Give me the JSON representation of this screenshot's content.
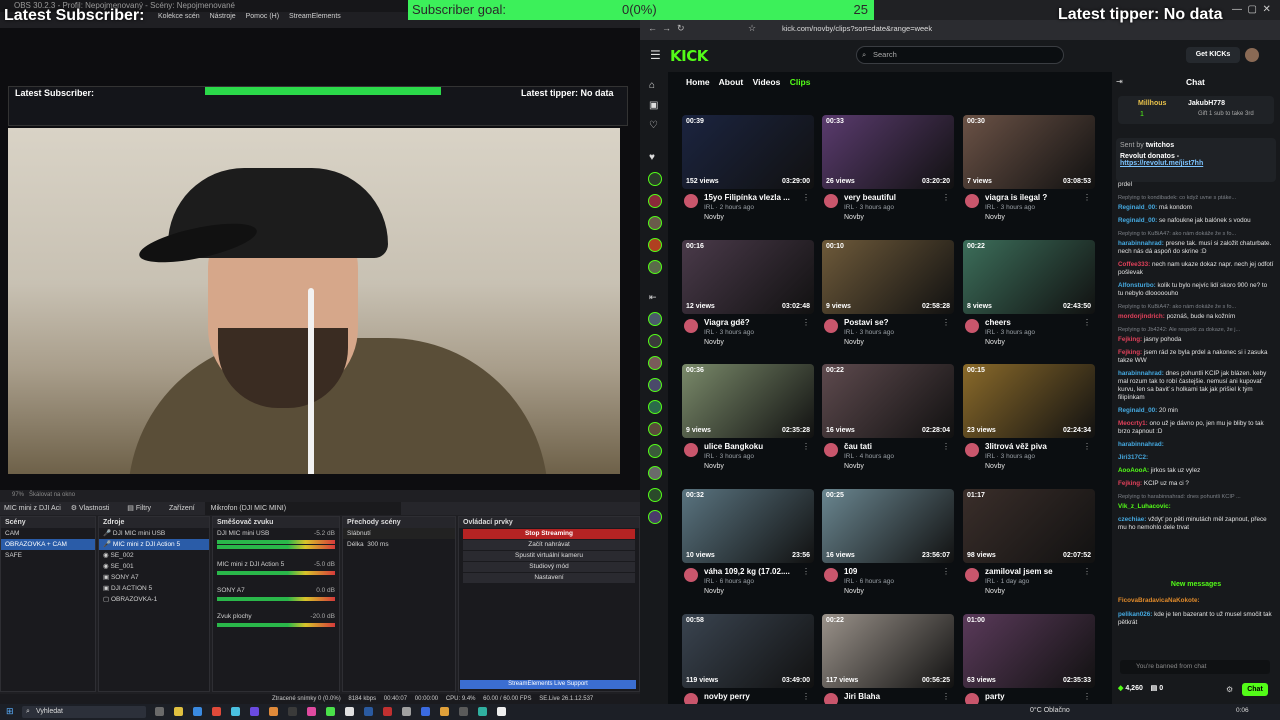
{
  "overlay": {
    "latest_subscriber": "Latest Subscriber:",
    "goal_label": "Subscriber goal:",
    "goal_value": "0(0%)",
    "goal_target": "25",
    "latest_tipper": "Latest tipper: No data"
  },
  "obs": {
    "menu": [
      "Kolekce scén",
      "Nástroje",
      "Pomoc (H)",
      "StreamElements"
    ],
    "scale_label": "97%",
    "scale_mode": "Škálovat na okno",
    "toolbar": {
      "selected_source": "MIC mini z DJI Aci",
      "properties": "Vlastnosti",
      "filters": "Filtry",
      "devices": "Zařízení",
      "device_value": "Mikrofon (DJI MIC MINI)"
    },
    "scenes": {
      "title": "Scény",
      "items": [
        "CAM",
        "OBRAZOVKA + CAM",
        "SAFE"
      ],
      "selected": 1
    },
    "sources": {
      "title": "Zdroje",
      "items": [
        "DJI MIC mini USB",
        "MIC mini z DJI Action 5",
        "SE_002",
        "SE_001",
        "SONY A7",
        "DJI ACTION 5",
        "OBRAZOVKA-1"
      ],
      "selected": 1
    },
    "mixer": {
      "title": "Směšovač zvuku",
      "channels": [
        {
          "name": "DJI MIC mini USB",
          "db": "-5.2 dB"
        },
        {
          "name": "MIC mini z DJI Action 5",
          "db": "-5.0 dB"
        },
        {
          "name": "SONY A7",
          "db": "0.0 dB"
        },
        {
          "name": "Zvuk plochy",
          "db": "-20.0 dB"
        }
      ]
    },
    "transitions": {
      "title": "Přechody scény",
      "type": "Slábnutí",
      "duration_label": "Délka",
      "duration": "300 ms"
    },
    "controls": {
      "title": "Ovládací prvky",
      "buttons": [
        "Stop Streaming",
        "Začít nahrávat",
        "Spustit virtuální kameru",
        "Studiový mód",
        "Nastavení"
      ]
    },
    "se_support": "StreamElements Live Support",
    "status": {
      "dropped": "Ztracené snímky 0 (0.0%)",
      "kbps": "8184 kbps",
      "time1": "00:40:07",
      "time2": "00:00:00",
      "cpu": "CPU: 9.4%",
      "fps": "60.00 / 60.00 FPS",
      "version": "SE.Live 26.1.12.537"
    }
  },
  "browser": {
    "url": "kick.com/novby/clips?sort=date&range=week",
    "search_placeholder": "Search",
    "get_kicks": "Get KICKs",
    "logo": "KICK",
    "tabs": [
      "Home",
      "About",
      "Videos",
      "Clips"
    ],
    "active_tab": "Clips",
    "clips": [
      {
        "dur": "00:39",
        "views": "152 views",
        "ts": "03:29:00",
        "title": "15yo Filipínka vlezla ...",
        "cat": "IRL · 2 hours ago",
        "channel": "Novby",
        "color": "#1b2440"
      },
      {
        "dur": "00:33",
        "views": "26 views",
        "ts": "03:20:20",
        "title": "very beautiful",
        "cat": "IRL · 3 hours ago",
        "channel": "Novby",
        "color": "#5a3b6e"
      },
      {
        "dur": "00:30",
        "views": "7 views",
        "ts": "03:08:53",
        "title": "viagra is ilegal ?",
        "cat": "IRL · 3 hours ago",
        "channel": "Novby",
        "color": "#6b5246"
      },
      {
        "dur": "00:16",
        "views": "12 views",
        "ts": "03:02:48",
        "title": "Viagra gdě?",
        "cat": "IRL · 3 hours ago",
        "channel": "Novby",
        "color": "#4a3a4a"
      },
      {
        "dur": "00:10",
        "views": "9 views",
        "ts": "02:58:28",
        "title": "Postavi se?",
        "cat": "IRL · 3 hours ago",
        "channel": "Novby",
        "color": "#6e5a3a"
      },
      {
        "dur": "00:22",
        "views": "8 views",
        "ts": "02:43:50",
        "title": "cheers",
        "cat": "IRL · 3 hours ago",
        "channel": "Novby",
        "color": "#3c6e5a"
      },
      {
        "dur": "00:36",
        "views": "9 views",
        "ts": "02:35:28",
        "title": "ulice Bangkoku",
        "cat": "IRL · 3 hours ago",
        "channel": "Novby",
        "color": "#7a8a6a"
      },
      {
        "dur": "00:22",
        "views": "16 views",
        "ts": "02:28:04",
        "title": "čau tati",
        "cat": "IRL · 4 hours ago",
        "channel": "Novby",
        "color": "#5e4a4e"
      },
      {
        "dur": "00:15",
        "views": "23 views",
        "ts": "02:24:34",
        "title": "3litrová věž piva",
        "cat": "IRL · 3 hours ago",
        "channel": "Novby",
        "color": "#8a6a2a"
      },
      {
        "dur": "00:32",
        "views": "10 views",
        "ts": "23:56",
        "title": "váha 109,2 kg (17.02....",
        "cat": "IRL · 6 hours ago",
        "channel": "Novby",
        "color": "#5a7480"
      },
      {
        "dur": "00:25",
        "views": "16 views",
        "ts": "23:56:07",
        "title": "109",
        "cat": "IRL · 6 hours ago",
        "channel": "Novby",
        "color": "#6a8690"
      },
      {
        "dur": "01:17",
        "views": "98 views",
        "ts": "02:07:52",
        "title": "zamilovaI jsem se",
        "cat": "IRL · 1 day ago",
        "channel": "Novby",
        "color": "#3a2e2a"
      },
      {
        "dur": "00:58",
        "views": "119 views",
        "ts": "03:49:00",
        "title": "novby perry",
        "cat": "",
        "channel": "",
        "color": "#3a4450"
      },
      {
        "dur": "00:22",
        "views": "117 views",
        "ts": "00:56:25",
        "title": "Jiri Blaha",
        "cat": "",
        "channel": "",
        "color": "#9a928a"
      },
      {
        "dur": "01:00",
        "views": "63 views",
        "ts": "02:35:33",
        "title": "party",
        "cat": "",
        "channel": "",
        "color": "#5a3a5a"
      }
    ]
  },
  "chat": {
    "title": "Chat",
    "gift": {
      "user1": "Millhous",
      "user2": "JakubH778",
      "count": "1",
      "text": "Gift 1 sub to take 3rd"
    },
    "pinned": {
      "sent_by": "Sent by",
      "user": "twitchos",
      "text": "Revolut donatos -",
      "link": "https://revolut.me/jist7hh"
    },
    "lines": [
      {
        "user": "",
        "text": "prdel",
        "reply": false,
        "color": "#e3e3e3"
      },
      {
        "user": "",
        "text": "Replying to kondibadek: co když uvne s ptáke...",
        "reply": true,
        "color": "#7c8087"
      },
      {
        "user": "Reginald_00:",
        "text": "má kondom",
        "reply": false,
        "color": "#45a9e0"
      },
      {
        "user": "Reginald_00:",
        "text": "se nafoukne jak balónek s vodou",
        "reply": false,
        "color": "#45a9e0"
      },
      {
        "user": "",
        "text": "Replying to KuBiA47: ako nám dokáže že s fo...",
        "reply": true,
        "color": "#7c8087"
      },
      {
        "user": "harabinnahrad:",
        "text": "presne tak. musí si založit chaturbate. nech nás dá aspoň do skrine :D",
        "reply": false,
        "color": "#45a9e0"
      },
      {
        "user": "Coffee333:",
        "text": "nech nam ukaze dokaz napr. nech jej odfotí pošlevak",
        "reply": false,
        "color": "#e0405a"
      },
      {
        "user": "Alfonsturbo:",
        "text": "kolik tu bylo nejvíc lidí skoro 900 ne? to tu nebylo dlooooouho",
        "reply": false,
        "color": "#45a9e0"
      },
      {
        "user": "",
        "text": "Replying to KuBiA47: ako nám dokáže že s fo...",
        "reply": true,
        "color": "#7c8087"
      },
      {
        "user": "mordorjindrich:",
        "text": "poznáš, bude na kožním",
        "reply": false,
        "color": "#e0405a"
      },
      {
        "user": "",
        "text": "Replying to Jb4242: Ale respekt za dokaze, že j...",
        "reply": true,
        "color": "#7c8087"
      },
      {
        "user": "Fejking:",
        "text": "jasny pohoda",
        "reply": false,
        "color": "#e0405a"
      },
      {
        "user": "Fejking:",
        "text": "jsem rád ze byla prdel a nakonec si i zasuka takze WW",
        "reply": false,
        "color": "#e0405a"
      },
      {
        "user": "harabinnahrad:",
        "text": "dnes pohuntli KCIP jak blázen. keby mal rozum tak to robí častejšie. nemusí ani kupovať kurvu, len sa baviť s holkami tak jak prišiel k tým filipínkam",
        "reply": false,
        "color": "#45a9e0"
      },
      {
        "user": "Reginald_00:",
        "text": "20 min",
        "reply": false,
        "color": "#45a9e0"
      },
      {
        "user": "Meocrty1:",
        "text": "ono už je dávno po, jen mu je bliby to tak brzo zapnout :D",
        "reply": false,
        "color": "#e0405a"
      },
      {
        "user": "harabinnahrad:",
        "text": "",
        "reply": false,
        "color": "#45a9e0"
      },
      {
        "user": "Jiri317C2:",
        "text": "",
        "reply": false,
        "color": "#45a9e0"
      },
      {
        "user": "AooAooA:",
        "text": "jirkos tak uz vylez",
        "reply": false,
        "color": "#53fc18"
      },
      {
        "user": "Fejking:",
        "text": "KCIP uz ma ci ?",
        "reply": false,
        "color": "#e0405a"
      },
      {
        "user": "",
        "text": "Replying to harabinnahrad: dnes pohuntli KCIP ...",
        "reply": true,
        "color": "#7c8087"
      },
      {
        "user": "Vik_z_Luhacovic:",
        "text": "",
        "reply": false,
        "color": "#53fc18"
      },
      {
        "user": "czechiae:",
        "text": "vždyť po pěti minutách měl zapnout, přece mu ho nemohlo dele trvat",
        "reply": false,
        "color": "#45a9e0"
      }
    ],
    "new_messages": "New messages",
    "after_new": [
      {
        "user": "FicovaBradavicaNaKokote:",
        "text": "",
        "color": "#e08a2a"
      },
      {
        "user": "pelikan026:",
        "text": "kde je ten bazerant to už musel smočit tak pětkrát",
        "color": "#45a9e0"
      }
    ],
    "banned": "You're banned from chat",
    "kicks": "4,260",
    "zero": "0",
    "send": "Chat"
  },
  "taskbar": {
    "search": "Vyhledat",
    "weather": "0°C  Oblačno",
    "time": "0:06"
  }
}
